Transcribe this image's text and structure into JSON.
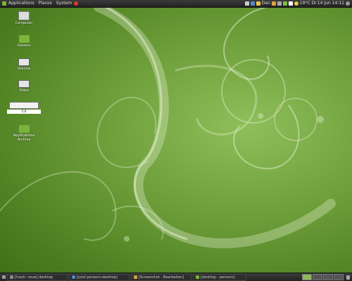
{
  "top_panel": {
    "menus": [
      "Applications",
      "Places",
      "System"
    ],
    "tray_text": {
      "user": "Dan",
      "temp": "19°C",
      "date": "Di 14 Jun",
      "time": "14:11"
    }
  },
  "desktop_icons": [
    {
      "label": "Computer",
      "icon": "monitor-icon"
    },
    {
      "label": "Dateien",
      "icon": "folder-icon"
    },
    {
      "label": "Volume",
      "icon": "drive-icon"
    },
    {
      "label": "Video",
      "icon": "drive-icon"
    },
    {
      "label": "Cd",
      "icon": "drive-icon",
      "selected": true
    },
    {
      "label": "Applications Archive",
      "icon": "folder-icon"
    }
  ],
  "taskbar": {
    "tasks": [
      {
        "label": "[trash: neue] desktop",
        "icon": "terminal-icon"
      },
      {
        "label": "[pool persons-desktop]",
        "icon": "browser-icon"
      },
      {
        "label": "[Screenshot - Bearbeiten]",
        "icon": "image-icon"
      },
      {
        "label": "[desktop - persons]",
        "icon": "folder-icon"
      }
    ],
    "workspace_count": 4
  },
  "colors": {
    "panel": "#222222",
    "desktop_bg": "#5a8b2a",
    "swirl": "#d8e8b8"
  }
}
